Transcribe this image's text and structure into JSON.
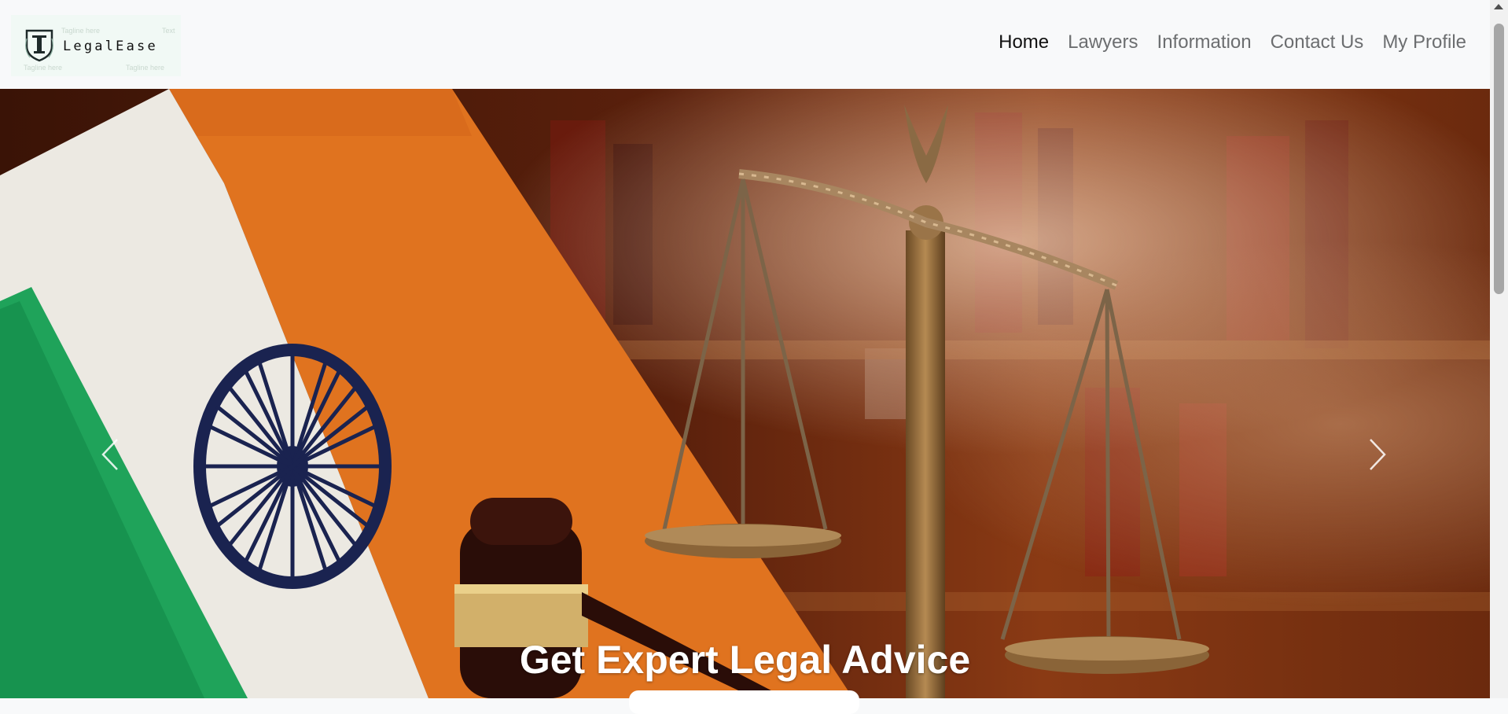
{
  "brand": {
    "name": "LegalEase",
    "faint_marks": [
      "Tagline here",
      "Text",
      "Tagline here",
      "Tagline here"
    ]
  },
  "nav": {
    "items": [
      {
        "label": "Home",
        "active": true
      },
      {
        "label": "Lawyers",
        "active": false
      },
      {
        "label": "Information",
        "active": false
      },
      {
        "label": "Contact Us",
        "active": false
      },
      {
        "label": "My Profile",
        "active": false
      }
    ]
  },
  "hero": {
    "heading": "Get Expert Legal Advice",
    "prev_icon": "chevron-left-icon",
    "next_icon": "chevron-right-icon",
    "button_label": ""
  },
  "colors": {
    "accent_text": "#111111",
    "nav_text": "#6c6e70",
    "saffron": "#e0731f",
    "india_green": "#1fa35a",
    "chakra_navy": "#1a2350"
  }
}
